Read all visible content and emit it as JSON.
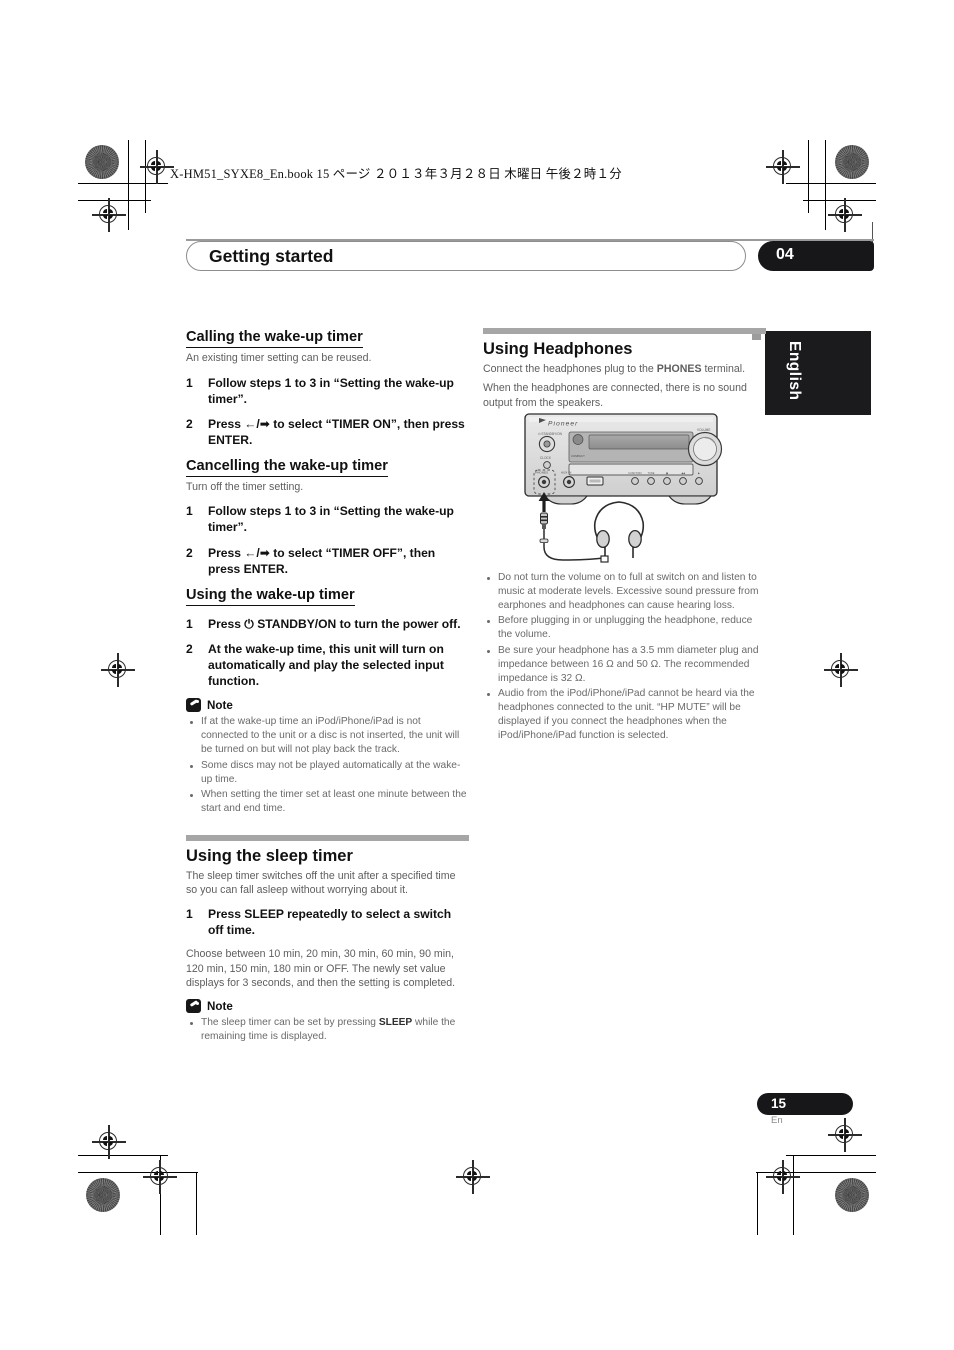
{
  "print": {
    "book_line": "X-HM51_SYXE8_En.book   15 ページ   ２０１３年３月２８日   木曜日   午後２時１分"
  },
  "header": {
    "chapter_title": "Getting started",
    "chapter_number": "04"
  },
  "language_tab": "English",
  "left_column": {
    "s1": {
      "heading": "Calling the wake-up timer",
      "lead": "An existing timer setting can be reused.",
      "steps": [
        {
          "num": "1",
          "text": "Follow steps 1 to 3 in “Setting the wake-up timer”."
        },
        {
          "num": "2",
          "text": "Press ←/➡ to select “TIMER ON”, then press ENTER."
        }
      ]
    },
    "s2": {
      "heading": "Cancelling the wake-up timer",
      "lead": "Turn off the timer setting.",
      "steps": [
        {
          "num": "1",
          "text": "Follow steps 1 to 3 in “Setting the wake-up timer”."
        },
        {
          "num": "2",
          "text": "Press ←/➡ to select “TIMER OFF”, then press ENTER."
        }
      ]
    },
    "s3": {
      "heading": "Using the wake-up timer",
      "steps": [
        {
          "num": "1",
          "text": "Press ⏻ STANDBY/ON to turn the power off."
        },
        {
          "num": "2",
          "text": "At the wake-up time, this unit will turn on automatically and play the selected input function."
        }
      ],
      "note_label": "Note",
      "notes": [
        "If at the wake-up time an iPod/iPhone/iPad is not connected to the unit or a disc is not inserted, the unit will be turned on but will not play back the track.",
        "Some discs may not be played automatically at the wake-up time.",
        "When setting the timer set at least one minute between the start and end time."
      ]
    },
    "s4": {
      "heading": "Using the sleep timer",
      "lead": "The sleep timer switches off the unit after a specified time so you can fall asleep without worrying about it.",
      "steps": [
        {
          "num": "1",
          "text": "Press SLEEP repeatedly to select a switch off time."
        }
      ],
      "body": "Choose between 10 min, 20 min, 30 min, 60 min, 90 min, 120 min, 150 min, 180 min or OFF. The newly set value displays for 3 seconds, and then the setting is completed.",
      "note_label": "Note",
      "notes_rich": [
        {
          "pre": "The sleep timer can be set by pressing ",
          "bold": "SLEEP",
          "post": " while the remaining time is displayed."
        }
      ]
    }
  },
  "right_column": {
    "heading": "Using Headphones",
    "lead_pre": "Connect the headphones plug to the ",
    "lead_bold": "PHONES",
    "lead_post": " terminal.",
    "lead2": "When the headphones are connected, there is no sound output from the speakers.",
    "illustration": {
      "brand": "Pioneer",
      "jack_label": "PHONES",
      "aux_label": "AUX IN"
    },
    "notes": [
      "Do not turn the volume on to full at switch on and listen to music at moderate levels. Excessive sound pressure from earphones and headphones can cause hearing loss.",
      "Before plugging in or unplugging the headphone, reduce the volume.",
      "Be sure your headphone has a 3.5 mm diameter plug and impedance between 16 Ω and 50 Ω. The recommended impedance is 32 Ω.",
      "Audio from the iPod/iPhone/iPad cannot be heard via the headphones connected to the unit. “HP MUTE” will be displayed if you connect the headphones when the iPod/iPhone/iPad function is selected."
    ]
  },
  "footer": {
    "page_number": "15",
    "page_suffix": "En"
  }
}
